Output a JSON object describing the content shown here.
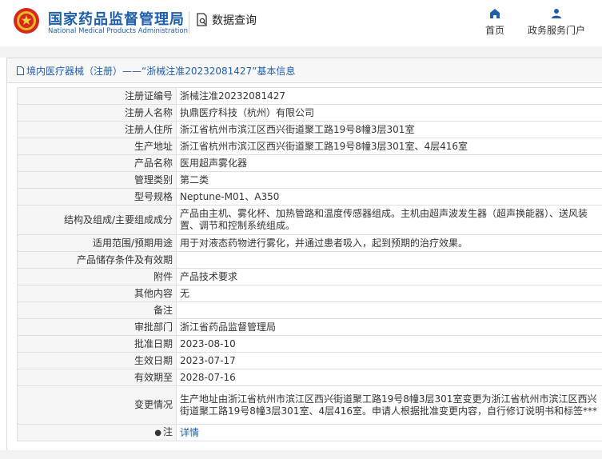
{
  "header": {
    "title_cn": "国家药品监督管理局",
    "title_en": "National Medical Products Administration",
    "query_label": "数据查询",
    "nav": [
      {
        "label": "首页",
        "icon": "home-icon"
      },
      {
        "label": "政务服务门户",
        "icon": "user-icon"
      }
    ]
  },
  "colors": {
    "brand": "#1f5ea8",
    "label_bg": "#f5f5f5",
    "border": "#e0e0e0"
  },
  "breadcrumb": {
    "text": "境内医疗器械（注册）——“浙械注准20232081427”基本信息"
  },
  "table": {
    "rows": [
      {
        "label": "注册证编号",
        "value": "浙械注准20232081427"
      },
      {
        "label": "注册人名称",
        "value": "执鼎医疗科技（杭州）有限公司"
      },
      {
        "label": "注册人住所",
        "value": "浙江省杭州市滨江区西兴街道聚工路19号8幢3层301室"
      },
      {
        "label": "生产地址",
        "value": "浙江省杭州市滨江区西兴街道聚工路19号8幢3层301室、4层416室"
      },
      {
        "label": "产品名称",
        "value": "医用超声雾化器"
      },
      {
        "label": "管理类别",
        "value": "第二类"
      },
      {
        "label": "型号规格",
        "value": "Neptune-M01、A350"
      },
      {
        "label": "结构及组成/主要组成成分",
        "value": "产品由主机、雾化杯、加热管路和温度传感器组成。主机由超声波发生器（超声换能器）、送风装置、调节和控制系统组成。"
      },
      {
        "label": "适用范围/预期用途",
        "value": "用于对液态药物进行雾化，并通过患者吸入，起到预期的治疗效果。"
      },
      {
        "label": "产品储存条件及有效期",
        "value": ""
      },
      {
        "label": "附件",
        "value": "产品技术要求"
      },
      {
        "label": "其他内容",
        "value": "无"
      },
      {
        "label": "备注",
        "value": ""
      },
      {
        "label": "审批部门",
        "value": "浙江省药品监督管理局"
      },
      {
        "label": "批准日期",
        "value": "2023-08-10"
      },
      {
        "label": "生效日期",
        "value": "2023-07-17"
      },
      {
        "label": "有效期至",
        "value": "2028-07-16"
      },
      {
        "label": "变更情况",
        "value": "生产地址由浙江省杭州市滨江区西兴街道聚工路19号8幢3层301室变更为浙江省杭州市滨江区西兴街道聚工路19号8幢3层301室、4层416室。申请人根据批准变更内容，自行修订说明书和标签***"
      }
    ],
    "note_label": "注",
    "note_link": "详情"
  }
}
